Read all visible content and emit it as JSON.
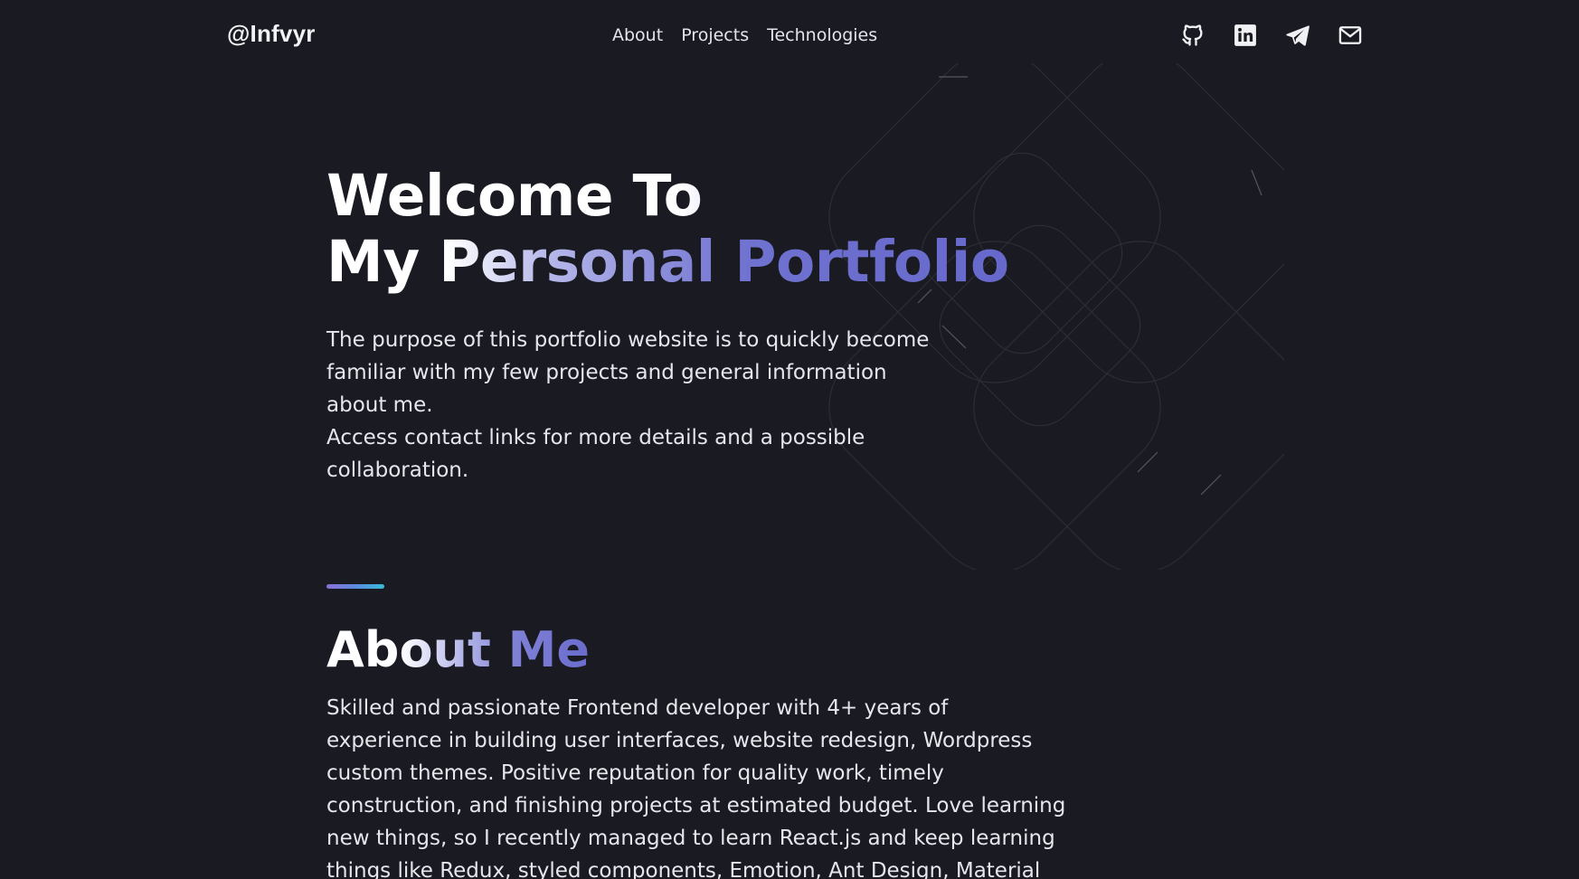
{
  "header": {
    "logo": "@Infvyr",
    "nav": [
      {
        "label": "About"
      },
      {
        "label": "Projects"
      },
      {
        "label": "Technologies"
      }
    ],
    "socials": [
      {
        "icon": "github-icon"
      },
      {
        "icon": "linkedin-icon"
      },
      {
        "icon": "telegram-icon"
      },
      {
        "icon": "mail-icon"
      }
    ]
  },
  "hero": {
    "title_line1": "Welcome To",
    "title_line2": "My Personal Portfolio",
    "paragraph1": "The purpose of this portfolio website is to quickly become familiar with my few projects and general information about me.",
    "paragraph2": "Access contact links for more details and a possible collaboration."
  },
  "about": {
    "title": "About Me",
    "text": "Skilled and passionate Frontend developer with 4+ years of experience in building user interfaces, website redesign, Wordpress custom themes. Positive reputation for quality work, timely construction, and finishing projects at estimated budget. Love learning new things, so I recently managed to learn React.js and keep learning things like Redux, styled components, Emotion, Ant Design, Material UI and many"
  },
  "colors": {
    "background": "#1a1b22",
    "accent_purple": "#6668cc",
    "accent_cyan": "#39b9d8"
  }
}
